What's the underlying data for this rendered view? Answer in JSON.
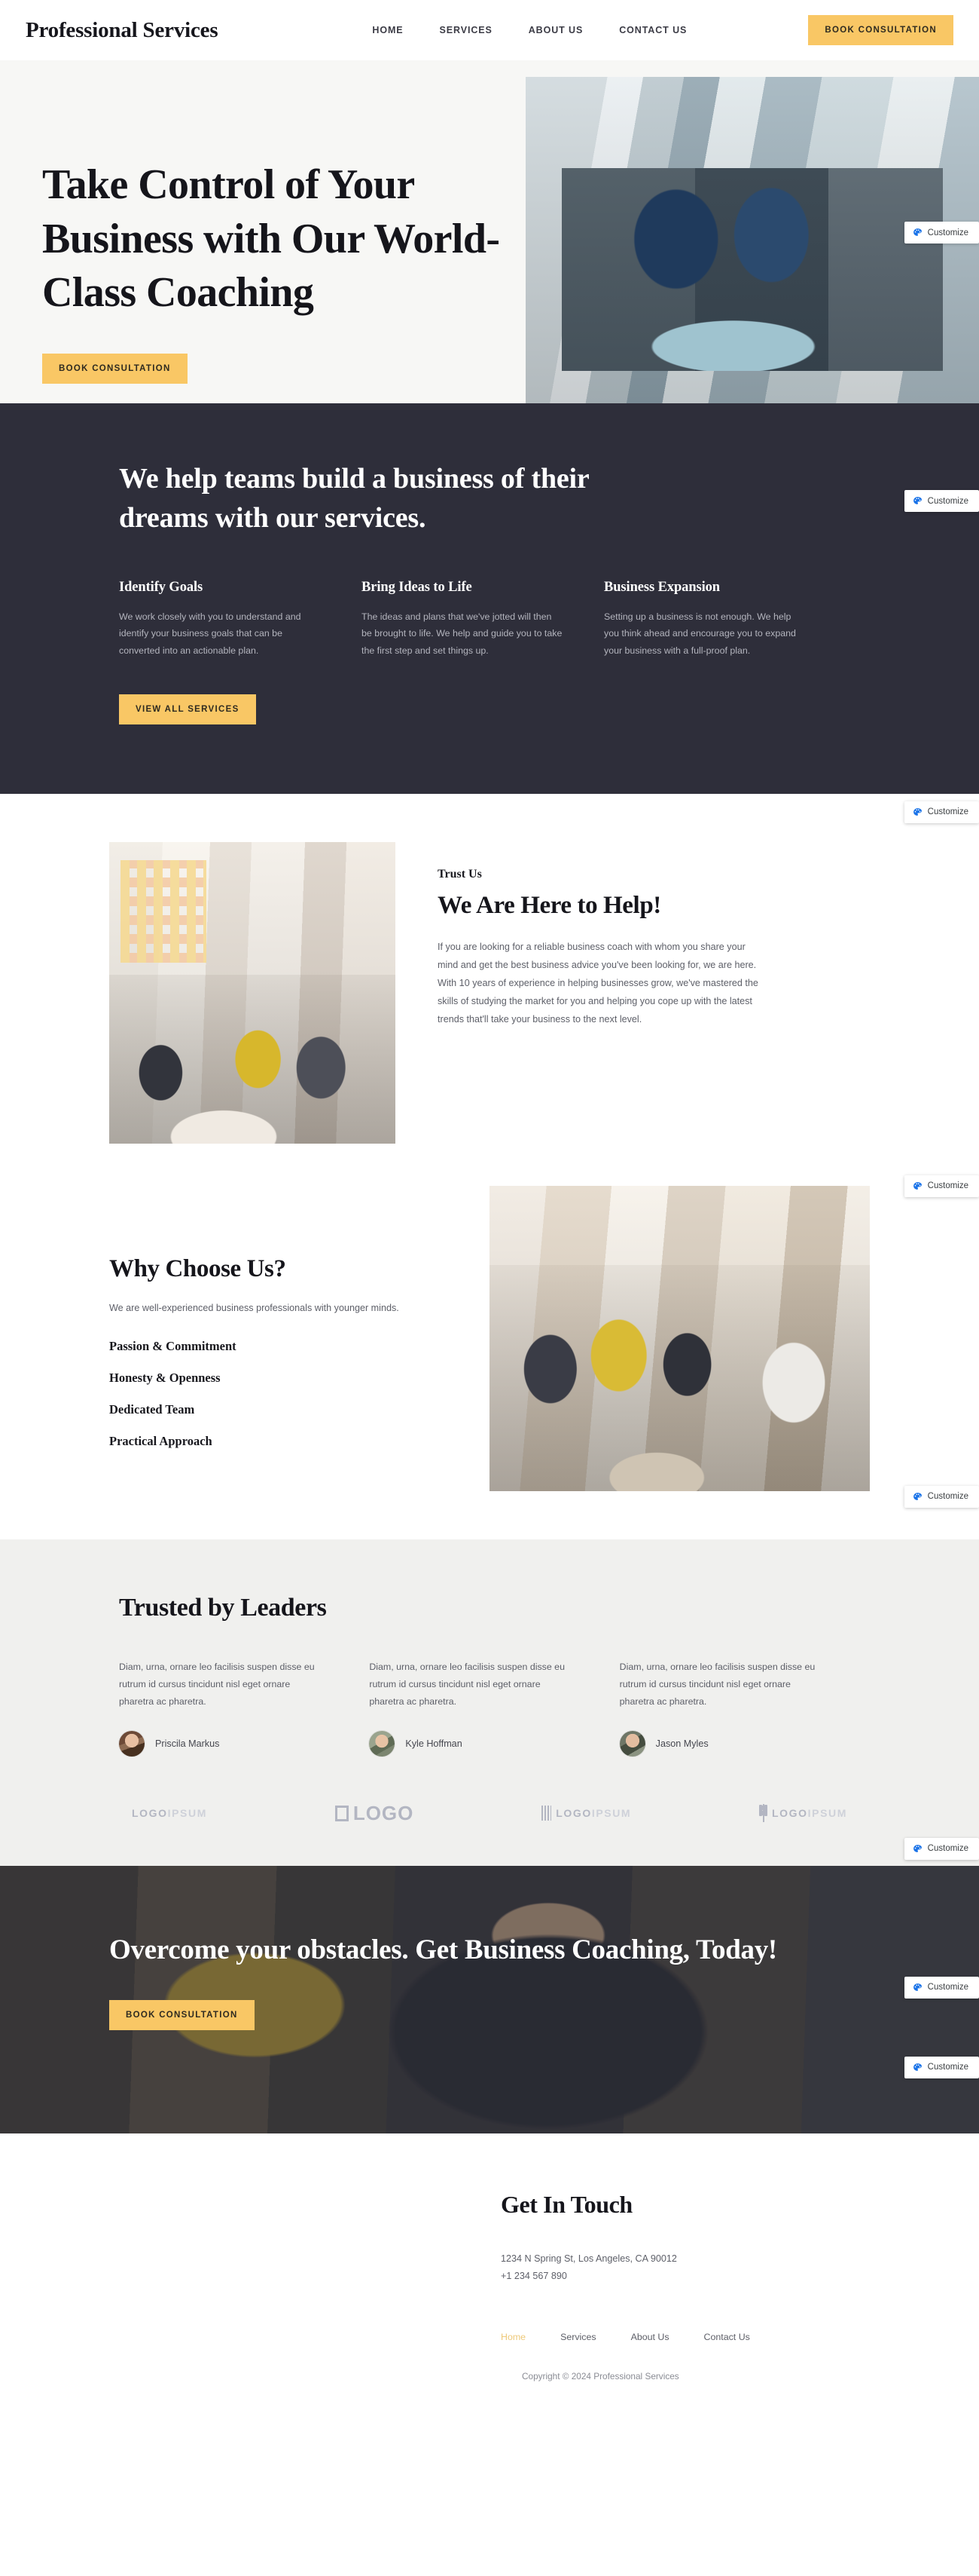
{
  "header": {
    "brand": "Professional Services",
    "nav": [
      {
        "label": "HOME"
      },
      {
        "label": "SERVICES"
      },
      {
        "label": "ABOUT US"
      },
      {
        "label": "CONTACT US"
      }
    ],
    "cta_label": "BOOK CONSULTATION"
  },
  "hero": {
    "title": "Take Control of Your Business with Our World-Class Coaching",
    "cta_label": "BOOK CONSULTATION"
  },
  "services": {
    "title": "We help teams build a business of their dreams with our services.",
    "cards": [
      {
        "title": "Identify Goals",
        "text": "We work closely with you to understand and identify your business goals that can be converted into an actionable plan."
      },
      {
        "title": "Bring Ideas to Life",
        "text": "The ideas and plans that we've jotted will then be brought to life. We help and guide you to take the first step and set things up."
      },
      {
        "title": "Business Expansion",
        "text": "Setting up a business is not enough. We help you think ahead and encourage you to expand your business with a full-proof plan."
      }
    ],
    "cta_label": "VIEW ALL SERVICES"
  },
  "help": {
    "eyebrow": "Trust Us",
    "title": "We Are Here to Help!",
    "text": "If you are looking for a reliable business coach with whom you share your mind and get the best business advice you've been looking for, we are here. With 10 years of experience in helping businesses grow, we've mastered the skills of studying the market for you and helping you cope up with the latest trends that'll take your business to the next level."
  },
  "why": {
    "title": "Why Choose Us?",
    "subtitle": "We are well-experienced business professionals with younger minds.",
    "items": [
      "Passion & Commitment",
      "Honesty & Openness",
      "Dedicated Team",
      "Practical Approach"
    ]
  },
  "testimonials": {
    "title": "Trusted by Leaders",
    "items": [
      {
        "quote": "Diam, urna, ornare leo facilisis suspen disse eu rutrum id cursus tincidunt nisl eget ornare pharetra ac pharetra.",
        "name": "Priscila Markus"
      },
      {
        "quote": "Diam, urna, ornare leo facilisis suspen disse eu rutrum id cursus tincidunt nisl eget ornare pharetra ac pharetra.",
        "name": "Kyle Hoffman"
      },
      {
        "quote": "Diam, urna, ornare leo facilisis suspen disse eu rutrum id cursus tincidunt nisl eget ornare pharetra ac pharetra.",
        "name": "Jason Myles"
      }
    ],
    "logos": [
      {
        "bold": "LOGO",
        "light": "IPSUM"
      },
      {
        "bold": "LOGO",
        "light": ""
      },
      {
        "bold": "LOGO",
        "light": "IPSUM"
      },
      {
        "bold": "LOGO",
        "light": "IPSUM"
      }
    ]
  },
  "cta": {
    "title": "Overcome your obstacles. Get Business Coaching, Today!",
    "cta_label": "BOOK CONSULTATION"
  },
  "footer": {
    "title": "Get In Touch",
    "address": "1234 N Spring St, Los Angeles, CA 90012",
    "phone": "+1 234 567 890",
    "nav": [
      {
        "label": "Home"
      },
      {
        "label": "Services"
      },
      {
        "label": "About Us"
      },
      {
        "label": "Contact Us"
      }
    ],
    "copyright": "Copyright © 2024 Professional Services"
  },
  "overlay": {
    "customize_label": "Customize",
    "icon": "palette-icon",
    "accent": "#f9c765",
    "dark": "#2e2e3a"
  }
}
